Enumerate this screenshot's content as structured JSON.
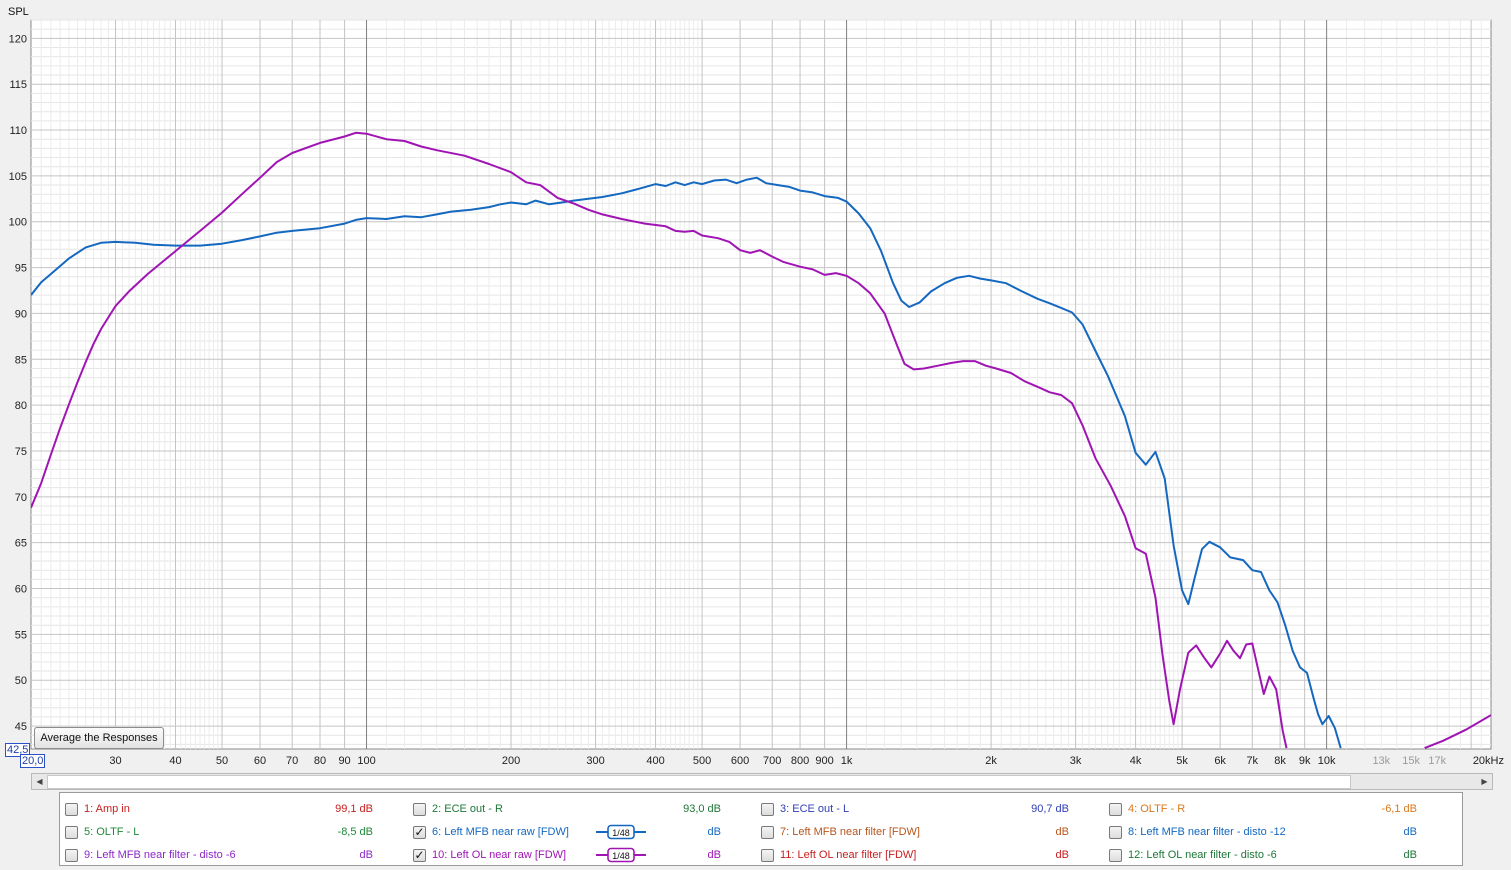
{
  "chart_data": {
    "type": "line",
    "ylabel": "SPL",
    "xscale": "log",
    "xlim": [
      20,
      22000
    ],
    "ylim": [
      42.5,
      122
    ],
    "y_ticks": [
      45,
      50,
      55,
      60,
      65,
      70,
      75,
      80,
      85,
      90,
      95,
      100,
      105,
      110,
      115,
      120
    ],
    "x_ticks": [
      {
        "v": 30,
        "t": "30"
      },
      {
        "v": 40,
        "t": "40"
      },
      {
        "v": 50,
        "t": "50"
      },
      {
        "v": 60,
        "t": "60"
      },
      {
        "v": 70,
        "t": "70"
      },
      {
        "v": 80,
        "t": "80"
      },
      {
        "v": 90,
        "t": "90"
      },
      {
        "v": 100,
        "t": "100"
      },
      {
        "v": 200,
        "t": "200"
      },
      {
        "v": 300,
        "t": "300"
      },
      {
        "v": 400,
        "t": "400"
      },
      {
        "v": 500,
        "t": "500"
      },
      {
        "v": 600,
        "t": "600"
      },
      {
        "v": 700,
        "t": "700"
      },
      {
        "v": 800,
        "t": "800"
      },
      {
        "v": 900,
        "t": "900"
      },
      {
        "v": 1000,
        "t": "1k"
      },
      {
        "v": 2000,
        "t": "2k"
      },
      {
        "v": 3000,
        "t": "3k"
      },
      {
        "v": 4000,
        "t": "4k"
      },
      {
        "v": 5000,
        "t": "5k"
      },
      {
        "v": 6000,
        "t": "6k"
      },
      {
        "v": 7000,
        "t": "7k"
      },
      {
        "v": 8000,
        "t": "8k"
      },
      {
        "v": 9000,
        "t": "9k"
      },
      {
        "v": 10000,
        "t": "10k"
      },
      {
        "v": 13000,
        "t": "13k",
        "faded": true
      },
      {
        "v": 15000,
        "t": "15k",
        "faded": true
      },
      {
        "v": 17000,
        "t": "17k",
        "faded": true
      },
      {
        "v": 22000,
        "t": "20kHz"
      }
    ],
    "grid": true,
    "legend_position": "bottom",
    "series": [
      {
        "name": "6: Left MFB near raw [FDW]",
        "color": "#1468c0",
        "points": [
          [
            20,
            92.0
          ],
          [
            21,
            93.4
          ],
          [
            22,
            94.3
          ],
          [
            24,
            96.0
          ],
          [
            26,
            97.2
          ],
          [
            28,
            97.7
          ],
          [
            30,
            97.8
          ],
          [
            33,
            97.7
          ],
          [
            36,
            97.5
          ],
          [
            40,
            97.4
          ],
          [
            45,
            97.4
          ],
          [
            50,
            97.6
          ],
          [
            55,
            98.0
          ],
          [
            60,
            98.4
          ],
          [
            65,
            98.8
          ],
          [
            70,
            99.0
          ],
          [
            80,
            99.3
          ],
          [
            90,
            99.8
          ],
          [
            95,
            100.2
          ],
          [
            100,
            100.4
          ],
          [
            110,
            100.3
          ],
          [
            120,
            100.6
          ],
          [
            130,
            100.5
          ],
          [
            140,
            100.8
          ],
          [
            150,
            101.1
          ],
          [
            165,
            101.3
          ],
          [
            180,
            101.6
          ],
          [
            190,
            101.9
          ],
          [
            200,
            102.1
          ],
          [
            215,
            101.9
          ],
          [
            225,
            102.3
          ],
          [
            240,
            101.9
          ],
          [
            255,
            102.1
          ],
          [
            270,
            102.3
          ],
          [
            290,
            102.5
          ],
          [
            310,
            102.7
          ],
          [
            340,
            103.1
          ],
          [
            370,
            103.6
          ],
          [
            400,
            104.1
          ],
          [
            420,
            103.9
          ],
          [
            440,
            104.3
          ],
          [
            460,
            104.0
          ],
          [
            480,
            104.3
          ],
          [
            500,
            104.1
          ],
          [
            530,
            104.5
          ],
          [
            560,
            104.6
          ],
          [
            590,
            104.2
          ],
          [
            620,
            104.6
          ],
          [
            650,
            104.8
          ],
          [
            680,
            104.2
          ],
          [
            720,
            104.0
          ],
          [
            760,
            103.8
          ],
          [
            800,
            103.4
          ],
          [
            850,
            103.2
          ],
          [
            900,
            102.8
          ],
          [
            960,
            102.6
          ],
          [
            1000,
            102.2
          ],
          [
            1060,
            100.9
          ],
          [
            1120,
            99.3
          ],
          [
            1180,
            96.8
          ],
          [
            1250,
            93.3
          ],
          [
            1300,
            91.4
          ],
          [
            1350,
            90.7
          ],
          [
            1420,
            91.2
          ],
          [
            1500,
            92.4
          ],
          [
            1600,
            93.3
          ],
          [
            1700,
            93.9
          ],
          [
            1800,
            94.1
          ],
          [
            1900,
            93.8
          ],
          [
            2000,
            93.6
          ],
          [
            2150,
            93.3
          ],
          [
            2300,
            92.5
          ],
          [
            2500,
            91.6
          ],
          [
            2650,
            91.1
          ],
          [
            2800,
            90.6
          ],
          [
            2950,
            90.1
          ],
          [
            3100,
            88.8
          ],
          [
            3300,
            85.9
          ],
          [
            3500,
            83.2
          ],
          [
            3800,
            78.8
          ],
          [
            4000,
            74.8
          ],
          [
            4200,
            73.5
          ],
          [
            4400,
            74.9
          ],
          [
            4600,
            72.0
          ],
          [
            4800,
            64.7
          ],
          [
            5000,
            59.8
          ],
          [
            5150,
            58.3
          ],
          [
            5300,
            61.0
          ],
          [
            5500,
            64.3
          ],
          [
            5700,
            65.1
          ],
          [
            6000,
            64.5
          ],
          [
            6300,
            63.4
          ],
          [
            6700,
            63.1
          ],
          [
            7000,
            62.0
          ],
          [
            7300,
            61.8
          ],
          [
            7600,
            59.8
          ],
          [
            7900,
            58.5
          ],
          [
            8200,
            56.0
          ],
          [
            8500,
            53.2
          ],
          [
            8800,
            51.4
          ],
          [
            9100,
            50.8
          ],
          [
            9400,
            48.0
          ],
          [
            9600,
            46.3
          ],
          [
            9800,
            45.2
          ],
          [
            10100,
            46.1
          ],
          [
            10400,
            44.8
          ],
          [
            10700,
            42.6
          ]
        ]
      },
      {
        "name": "10: Left OL near raw [FDW]",
        "color": "#a014b4",
        "points": [
          [
            20,
            68.8
          ],
          [
            21,
            71.5
          ],
          [
            22,
            74.6
          ],
          [
            23,
            77.5
          ],
          [
            24,
            80.1
          ],
          [
            25,
            82.5
          ],
          [
            26,
            84.7
          ],
          [
            27,
            86.7
          ],
          [
            28,
            88.3
          ],
          [
            29,
            89.6
          ],
          [
            30,
            90.8
          ],
          [
            32,
            92.4
          ],
          [
            35,
            94.3
          ],
          [
            40,
            96.8
          ],
          [
            45,
            99.0
          ],
          [
            50,
            101.0
          ],
          [
            55,
            103.0
          ],
          [
            60,
            104.8
          ],
          [
            65,
            106.5
          ],
          [
            70,
            107.5
          ],
          [
            80,
            108.6
          ],
          [
            90,
            109.3
          ],
          [
            95,
            109.7
          ],
          [
            100,
            109.6
          ],
          [
            110,
            109.0
          ],
          [
            120,
            108.8
          ],
          [
            130,
            108.2
          ],
          [
            140,
            107.8
          ],
          [
            160,
            107.2
          ],
          [
            180,
            106.3
          ],
          [
            200,
            105.4
          ],
          [
            215,
            104.3
          ],
          [
            230,
            104.0
          ],
          [
            250,
            102.6
          ],
          [
            270,
            102.0
          ],
          [
            290,
            101.3
          ],
          [
            310,
            100.8
          ],
          [
            340,
            100.3
          ],
          [
            380,
            99.8
          ],
          [
            420,
            99.5
          ],
          [
            440,
            99.0
          ],
          [
            460,
            98.9
          ],
          [
            480,
            99.0
          ],
          [
            500,
            98.5
          ],
          [
            540,
            98.2
          ],
          [
            570,
            97.8
          ],
          [
            600,
            96.9
          ],
          [
            630,
            96.6
          ],
          [
            660,
            96.9
          ],
          [
            700,
            96.2
          ],
          [
            740,
            95.6
          ],
          [
            800,
            95.1
          ],
          [
            850,
            94.8
          ],
          [
            900,
            94.2
          ],
          [
            950,
            94.4
          ],
          [
            1000,
            94.1
          ],
          [
            1060,
            93.3
          ],
          [
            1120,
            92.2
          ],
          [
            1200,
            90.0
          ],
          [
            1270,
            86.7
          ],
          [
            1320,
            84.5
          ],
          [
            1380,
            83.9
          ],
          [
            1450,
            84.0
          ],
          [
            1550,
            84.3
          ],
          [
            1650,
            84.6
          ],
          [
            1750,
            84.8
          ],
          [
            1850,
            84.8
          ],
          [
            1950,
            84.3
          ],
          [
            2050,
            84.0
          ],
          [
            2200,
            83.5
          ],
          [
            2350,
            82.6
          ],
          [
            2500,
            82.0
          ],
          [
            2650,
            81.4
          ],
          [
            2800,
            81.1
          ],
          [
            2950,
            80.2
          ],
          [
            3100,
            77.8
          ],
          [
            3300,
            74.2
          ],
          [
            3550,
            71.2
          ],
          [
            3800,
            67.9
          ],
          [
            4000,
            64.4
          ],
          [
            4200,
            63.8
          ],
          [
            4400,
            59.0
          ],
          [
            4550,
            52.8
          ],
          [
            4700,
            47.8
          ],
          [
            4800,
            45.2
          ],
          [
            4950,
            49.0
          ],
          [
            5150,
            53.0
          ],
          [
            5350,
            53.8
          ],
          [
            5550,
            52.5
          ],
          [
            5750,
            51.4
          ],
          [
            6000,
            52.9
          ],
          [
            6200,
            54.3
          ],
          [
            6400,
            53.2
          ],
          [
            6600,
            52.4
          ],
          [
            6800,
            53.9
          ],
          [
            7000,
            54.0
          ],
          [
            7200,
            51.2
          ],
          [
            7400,
            48.5
          ],
          [
            7600,
            50.4
          ],
          [
            7850,
            49.0
          ],
          [
            8100,
            44.5
          ],
          [
            8250,
            42.6
          ]
        ],
        "tail": [
          [
            16000,
            42.6
          ],
          [
            17500,
            43.4
          ],
          [
            19500,
            44.6
          ],
          [
            22000,
            46.2
          ]
        ]
      }
    ]
  },
  "ui": {
    "y_axis_title": "SPL",
    "ymin_box": "42,5",
    "xmin_box": "20,0",
    "average_button": "Average the Responses",
    "scroll_left": "◀",
    "scroll_right": "▶"
  },
  "legend": [
    [
      {
        "label": "1: Amp in",
        "value": "99,1 dB",
        "color": "#c81e1e",
        "checked": false,
        "smoothing": null
      },
      {
        "label": "2: ECE out - R",
        "value": "93,0 dB",
        "color": "#1e7838",
        "checked": false,
        "smoothing": null
      },
      {
        "label": "3: ECE out - L",
        "value": "90,7 dB",
        "color": "#3040b8",
        "checked": false,
        "smoothing": null
      },
      {
        "label": "4: OLTF - R",
        "value": "-6,1 dB",
        "color": "#d8781e",
        "checked": false,
        "smoothing": null
      }
    ],
    [
      {
        "label": "5: OLTF - L",
        "value": "-8,5 dB",
        "color": "#208838",
        "checked": false,
        "smoothing": null
      },
      {
        "label": "6: Left MFB near raw [FDW]",
        "value": "dB",
        "color": "#1468c0",
        "checked": true,
        "smoothing": "1/48"
      },
      {
        "label": "7: Left MFB near filter [FDW]",
        "value": "dB",
        "color": "#b8561e",
        "checked": false,
        "smoothing": null
      },
      {
        "label": "8: Left MFB near filter - disto -12",
        "value": "dB",
        "color": "#1468c0",
        "checked": false,
        "smoothing": null
      }
    ],
    [
      {
        "label": "9: Left MFB near filter - disto -6",
        "value": "dB",
        "color": "#8c28c8",
        "checked": false,
        "smoothing": null
      },
      {
        "label": "10: Left OL near raw [FDW]",
        "value": "dB",
        "color": "#a014b4",
        "checked": true,
        "smoothing": "1/48"
      },
      {
        "label": "11: Left OL near filter [FDW]",
        "value": "dB",
        "color": "#c81e1e",
        "checked": false,
        "smoothing": null
      },
      {
        "label": "12: Left OL near filter - disto -6",
        "value": "dB",
        "color": "#1e7838",
        "checked": false,
        "smoothing": null
      }
    ]
  ]
}
